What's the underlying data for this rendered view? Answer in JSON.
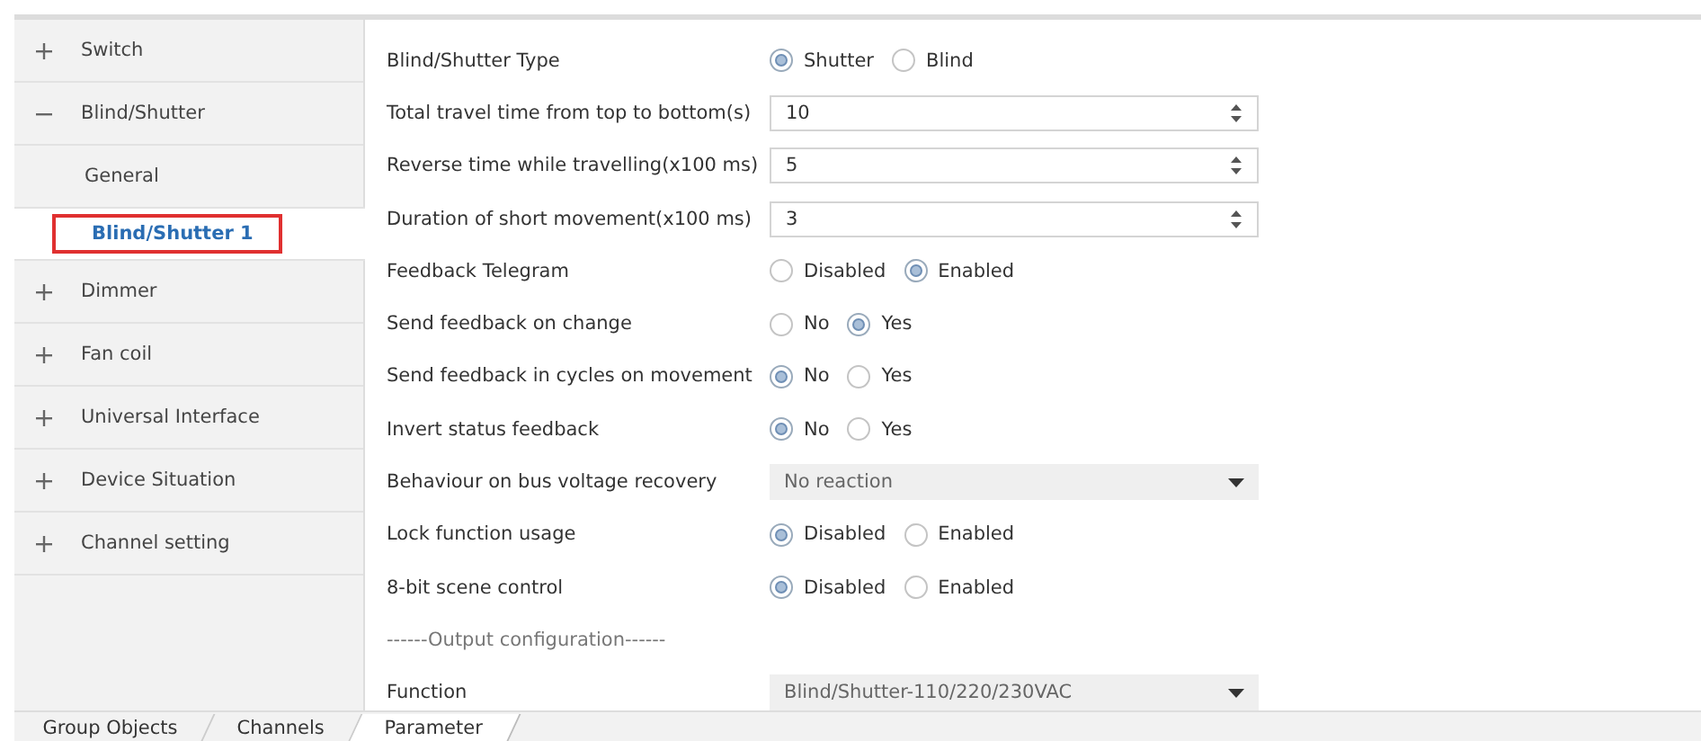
{
  "sidebar": {
    "items": [
      {
        "kind": "group",
        "label": "Switch",
        "expanded": false
      },
      {
        "kind": "group",
        "label": "Blind/Shutter",
        "expanded": true,
        "children": [
          {
            "label": "General",
            "selected": false
          },
          {
            "label": "Blind/Shutter 1",
            "selected": true
          }
        ]
      },
      {
        "kind": "group",
        "label": "Dimmer",
        "expanded": false
      },
      {
        "kind": "group",
        "label": "Fan coil",
        "expanded": false
      },
      {
        "kind": "group",
        "label": "Universal Interface",
        "expanded": false
      },
      {
        "kind": "group",
        "label": "Device Situation",
        "expanded": false
      },
      {
        "kind": "group",
        "label": "Channel setting",
        "expanded": false
      }
    ]
  },
  "parameters": [
    {
      "kind": "radio",
      "label": "Blind/Shutter Type",
      "options": [
        {
          "label": "Shutter",
          "selected": true
        },
        {
          "label": "Blind",
          "selected": false
        }
      ]
    },
    {
      "kind": "spin",
      "label": "Total travel time from top to bottom(s)",
      "value": "10"
    },
    {
      "kind": "spin",
      "label": "Reverse time while travelling(x100 ms)",
      "value": "5"
    },
    {
      "kind": "spin",
      "label": "Duration of short movement(x100 ms)",
      "value": "3"
    },
    {
      "kind": "radio",
      "label": "Feedback Telegram",
      "options": [
        {
          "label": "Disabled",
          "selected": false
        },
        {
          "label": "Enabled",
          "selected": true
        }
      ]
    },
    {
      "kind": "radio",
      "label": "Send feedback on change",
      "options": [
        {
          "label": "No",
          "selected": false
        },
        {
          "label": "Yes",
          "selected": true
        }
      ]
    },
    {
      "kind": "radio",
      "label": "Send feedback in cycles on movement",
      "options": [
        {
          "label": "No",
          "selected": true
        },
        {
          "label": "Yes",
          "selected": false
        }
      ]
    },
    {
      "kind": "radio",
      "label": "Invert status feedback",
      "options": [
        {
          "label": "No",
          "selected": true
        },
        {
          "label": "Yes",
          "selected": false
        }
      ]
    },
    {
      "kind": "select",
      "label": "Behaviour on bus voltage recovery",
      "value": "No reaction"
    },
    {
      "kind": "radio",
      "label": "Lock function usage",
      "options": [
        {
          "label": "Disabled",
          "selected": true
        },
        {
          "label": "Enabled",
          "selected": false
        }
      ]
    },
    {
      "kind": "radio",
      "label": "8-bit scene control",
      "options": [
        {
          "label": "Disabled",
          "selected": true
        },
        {
          "label": "Enabled",
          "selected": false
        }
      ]
    },
    {
      "kind": "heading",
      "label": "------Output configuration------"
    },
    {
      "kind": "select",
      "label": "Function",
      "value": "Blind/Shutter-110/220/230VAC"
    }
  ],
  "tabs": [
    {
      "label": "Group Objects",
      "selected": false
    },
    {
      "label": "Channels",
      "selected": false
    },
    {
      "label": "Parameter",
      "selected": true
    }
  ]
}
